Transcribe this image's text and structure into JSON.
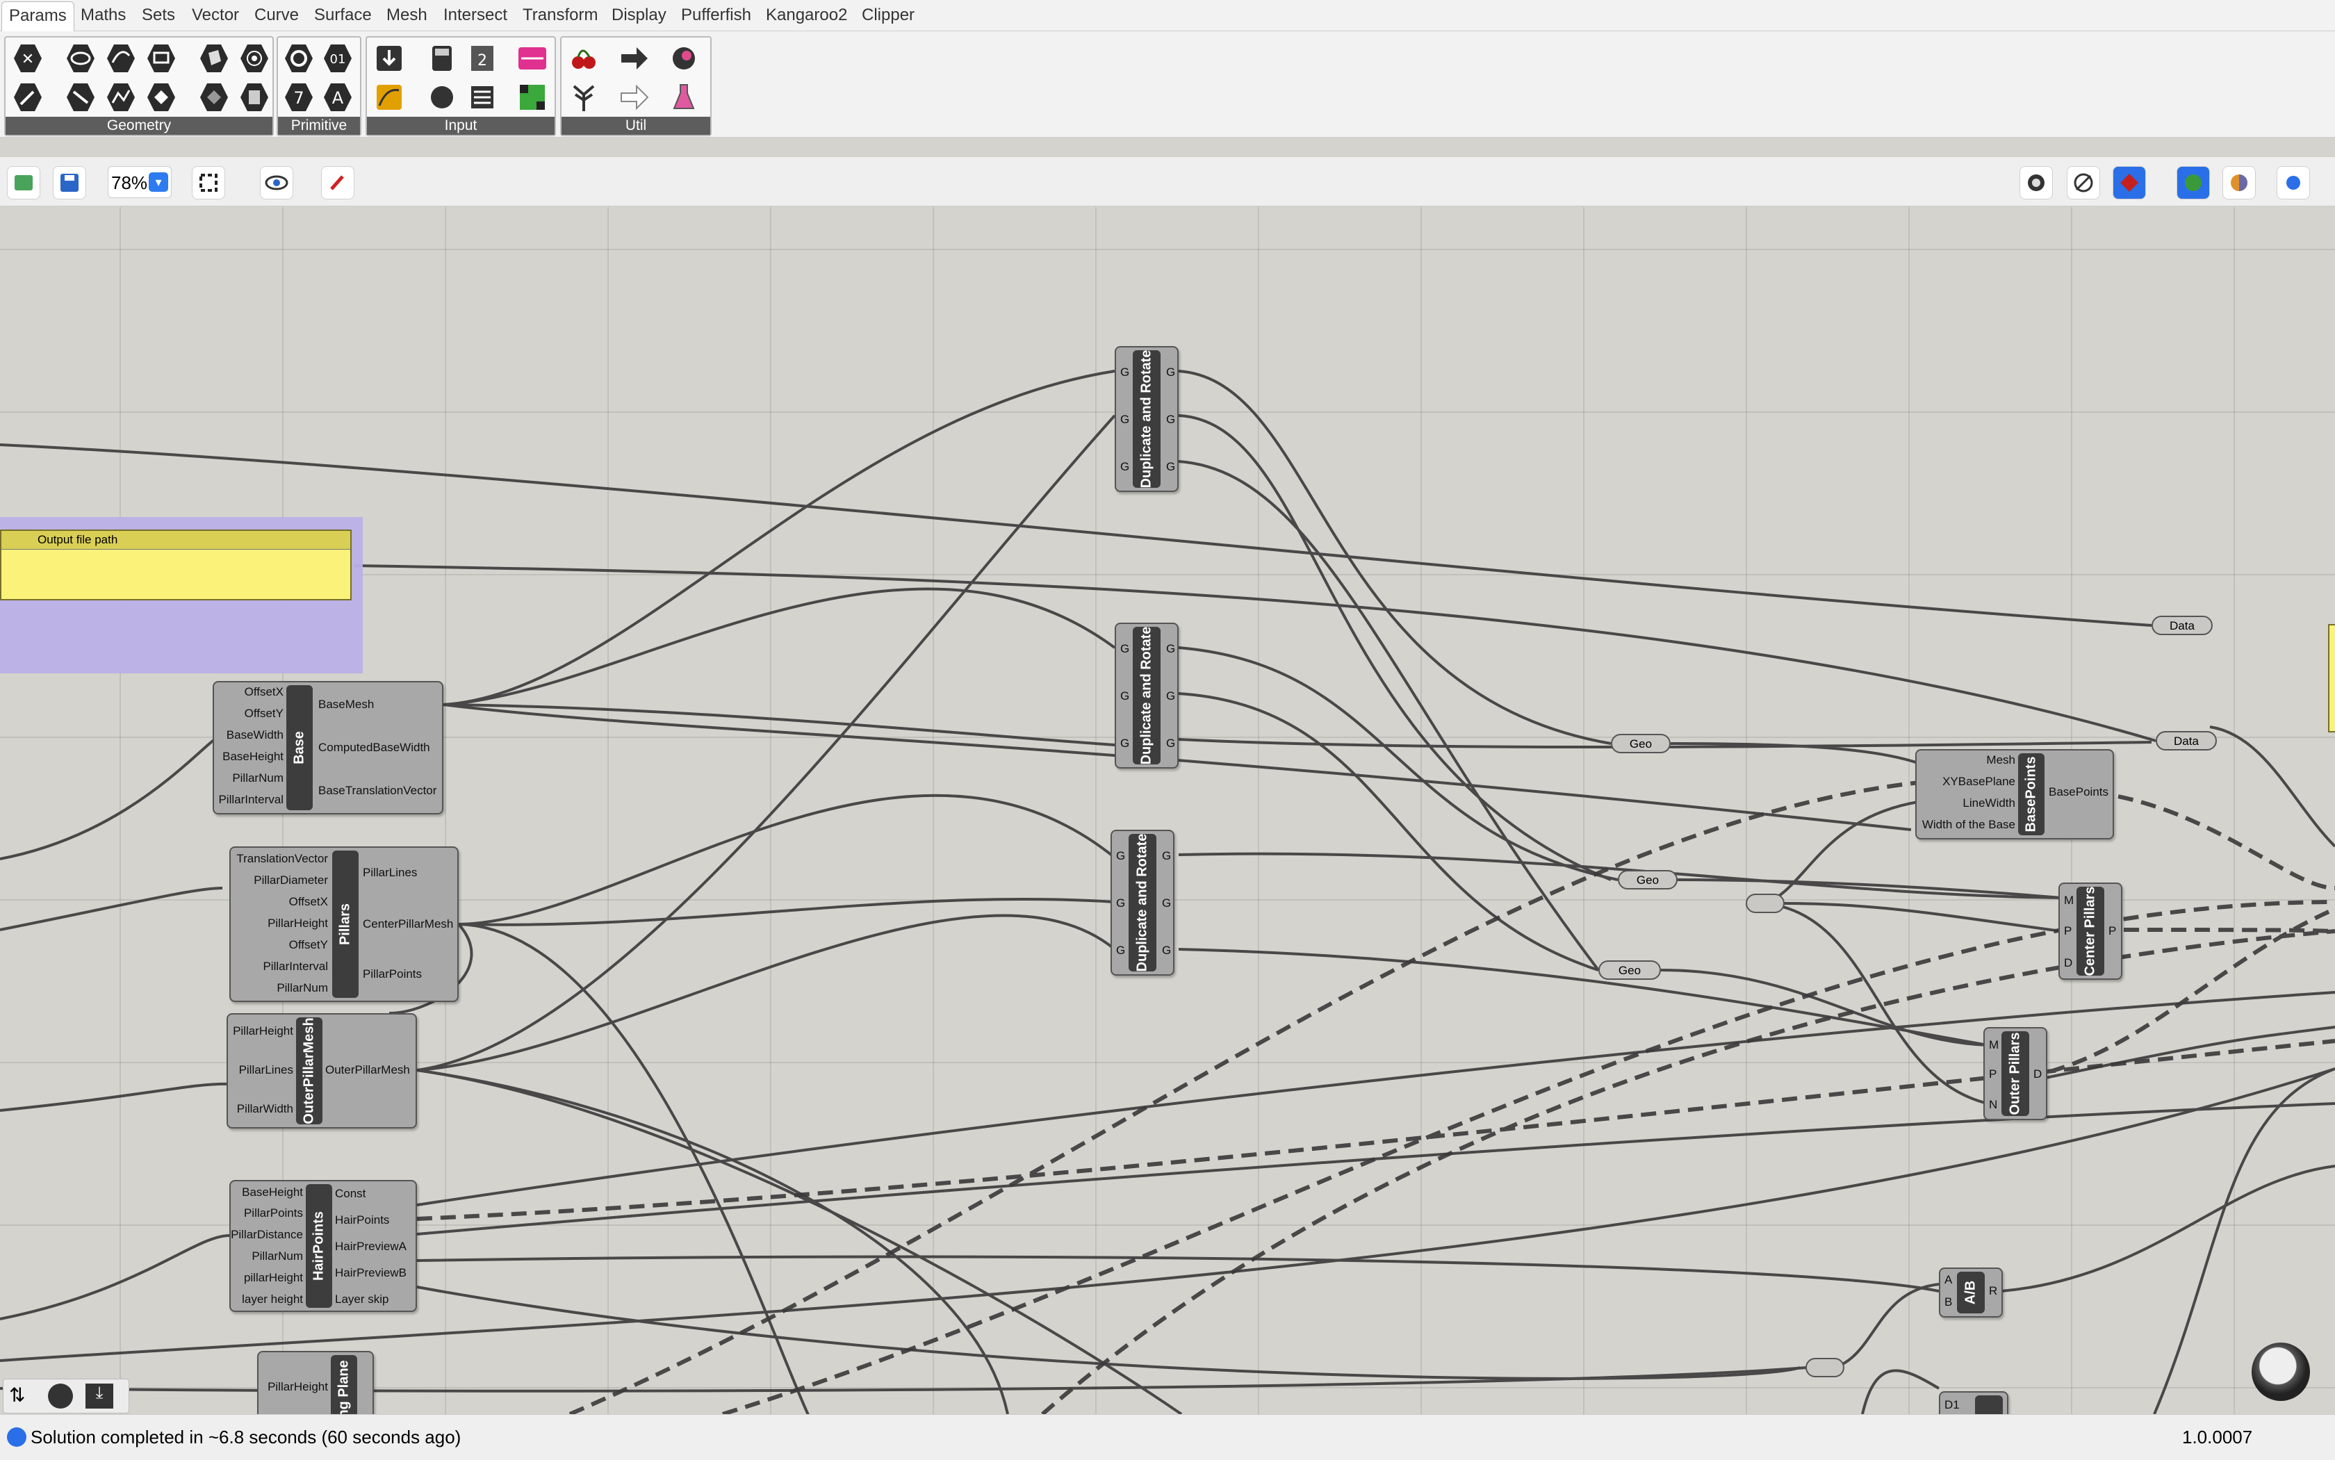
{
  "menu": {
    "tabs": [
      "Params",
      "Maths",
      "Sets",
      "Vector",
      "Curve",
      "Surface",
      "Mesh",
      "Intersect",
      "Transform",
      "Display",
      "Pufferfish",
      "Kangaroo2",
      "Clipper"
    ],
    "active_tab": "Params"
  },
  "ribbon": {
    "panels": [
      {
        "label": "Geometry"
      },
      {
        "label": "Primitive"
      },
      {
        "label": "Input"
      },
      {
        "label": "Util"
      }
    ]
  },
  "toolbar": {
    "zoom": "78%"
  },
  "canvas": {
    "note_panel": {
      "title": "Output file path",
      "value": ""
    },
    "components": {
      "dup_rotate_1": {
        "title": "Duplicate and Rotate",
        "inputs": [
          "G",
          "G",
          "G"
        ],
        "outputs": [
          "G",
          "G",
          "G"
        ]
      },
      "dup_rotate_2": {
        "title": "Duplicate and Rotate",
        "inputs": [
          "G",
          "G",
          "G"
        ],
        "outputs": [
          "G",
          "G",
          "G"
        ]
      },
      "dup_rotate_3": {
        "title": "Duplicate and Rotate",
        "inputs": [
          "G",
          "G",
          "G"
        ],
        "outputs": [
          "G",
          "G",
          "G"
        ]
      },
      "base": {
        "title": "Base",
        "inputs": [
          "OffsetX",
          "OffsetY",
          "BaseWidth",
          "BaseHeight",
          "PillarNum",
          "PillarInterval"
        ],
        "outputs": [
          "BaseMesh",
          "ComputedBaseWidth",
          "BaseTranslationVector"
        ]
      },
      "pillars": {
        "title": "Pillars",
        "inputs": [
          "TranslationVector",
          "PillarDiameter",
          "OffsetX",
          "PillarHeight",
          "OffsetY",
          "PillarInterval",
          "PillarNum"
        ],
        "outputs": [
          "PillarLines",
          "CenterPillarMesh",
          "PillarPoints"
        ]
      },
      "outer_pillar_mesh": {
        "title": "OuterPillarMesh",
        "inputs": [
          "PillarHeight",
          "PillarLines",
          "PillarWidth"
        ],
        "outputs": [
          "OuterPillarMesh"
        ]
      },
      "hair_points": {
        "title": "HairPoints",
        "inputs": [
          "BaseHeight",
          "PillarPoints",
          "PillarDistance",
          "PillarNum",
          "pillarHeight",
          "layer height"
        ],
        "outputs": [
          "Const",
          "HairPoints",
          "HairPreviewA",
          "HairPreviewB",
          "Layer skip"
        ]
      },
      "plane_partial": {
        "title": "ng Plane",
        "inputs": [
          "PillarHeight"
        ],
        "outputs": []
      },
      "base_points": {
        "title": "BasePoints",
        "inputs": [
          "Mesh",
          "XYBasePlane",
          "LineWidth",
          "Width of the Base"
        ],
        "outputs": [
          "BasePoints"
        ]
      },
      "center_pillars": {
        "title": "Center Pillars",
        "inputs": [
          "M",
          "P",
          "D"
        ],
        "outputs": [
          "P"
        ]
      },
      "outer_pillars": {
        "title": "Outer Pillars",
        "inputs": [
          "M",
          "P",
          "N"
        ],
        "outputs": [
          "D"
        ]
      },
      "division": {
        "title": "A/B",
        "inputs": [
          "A",
          "B"
        ],
        "outputs": [
          "R"
        ]
      },
      "d1_partial": {
        "title": "",
        "inputs": [
          "D1"
        ],
        "outputs": []
      }
    },
    "params": {
      "geo1": "Geo",
      "geo2": "Geo",
      "geo3": "Geo",
      "data1": "Data",
      "data2": "Data"
    }
  },
  "status": {
    "message": "Solution completed in ~6.8 seconds (60 seconds ago)",
    "version": "1.0.0007"
  }
}
